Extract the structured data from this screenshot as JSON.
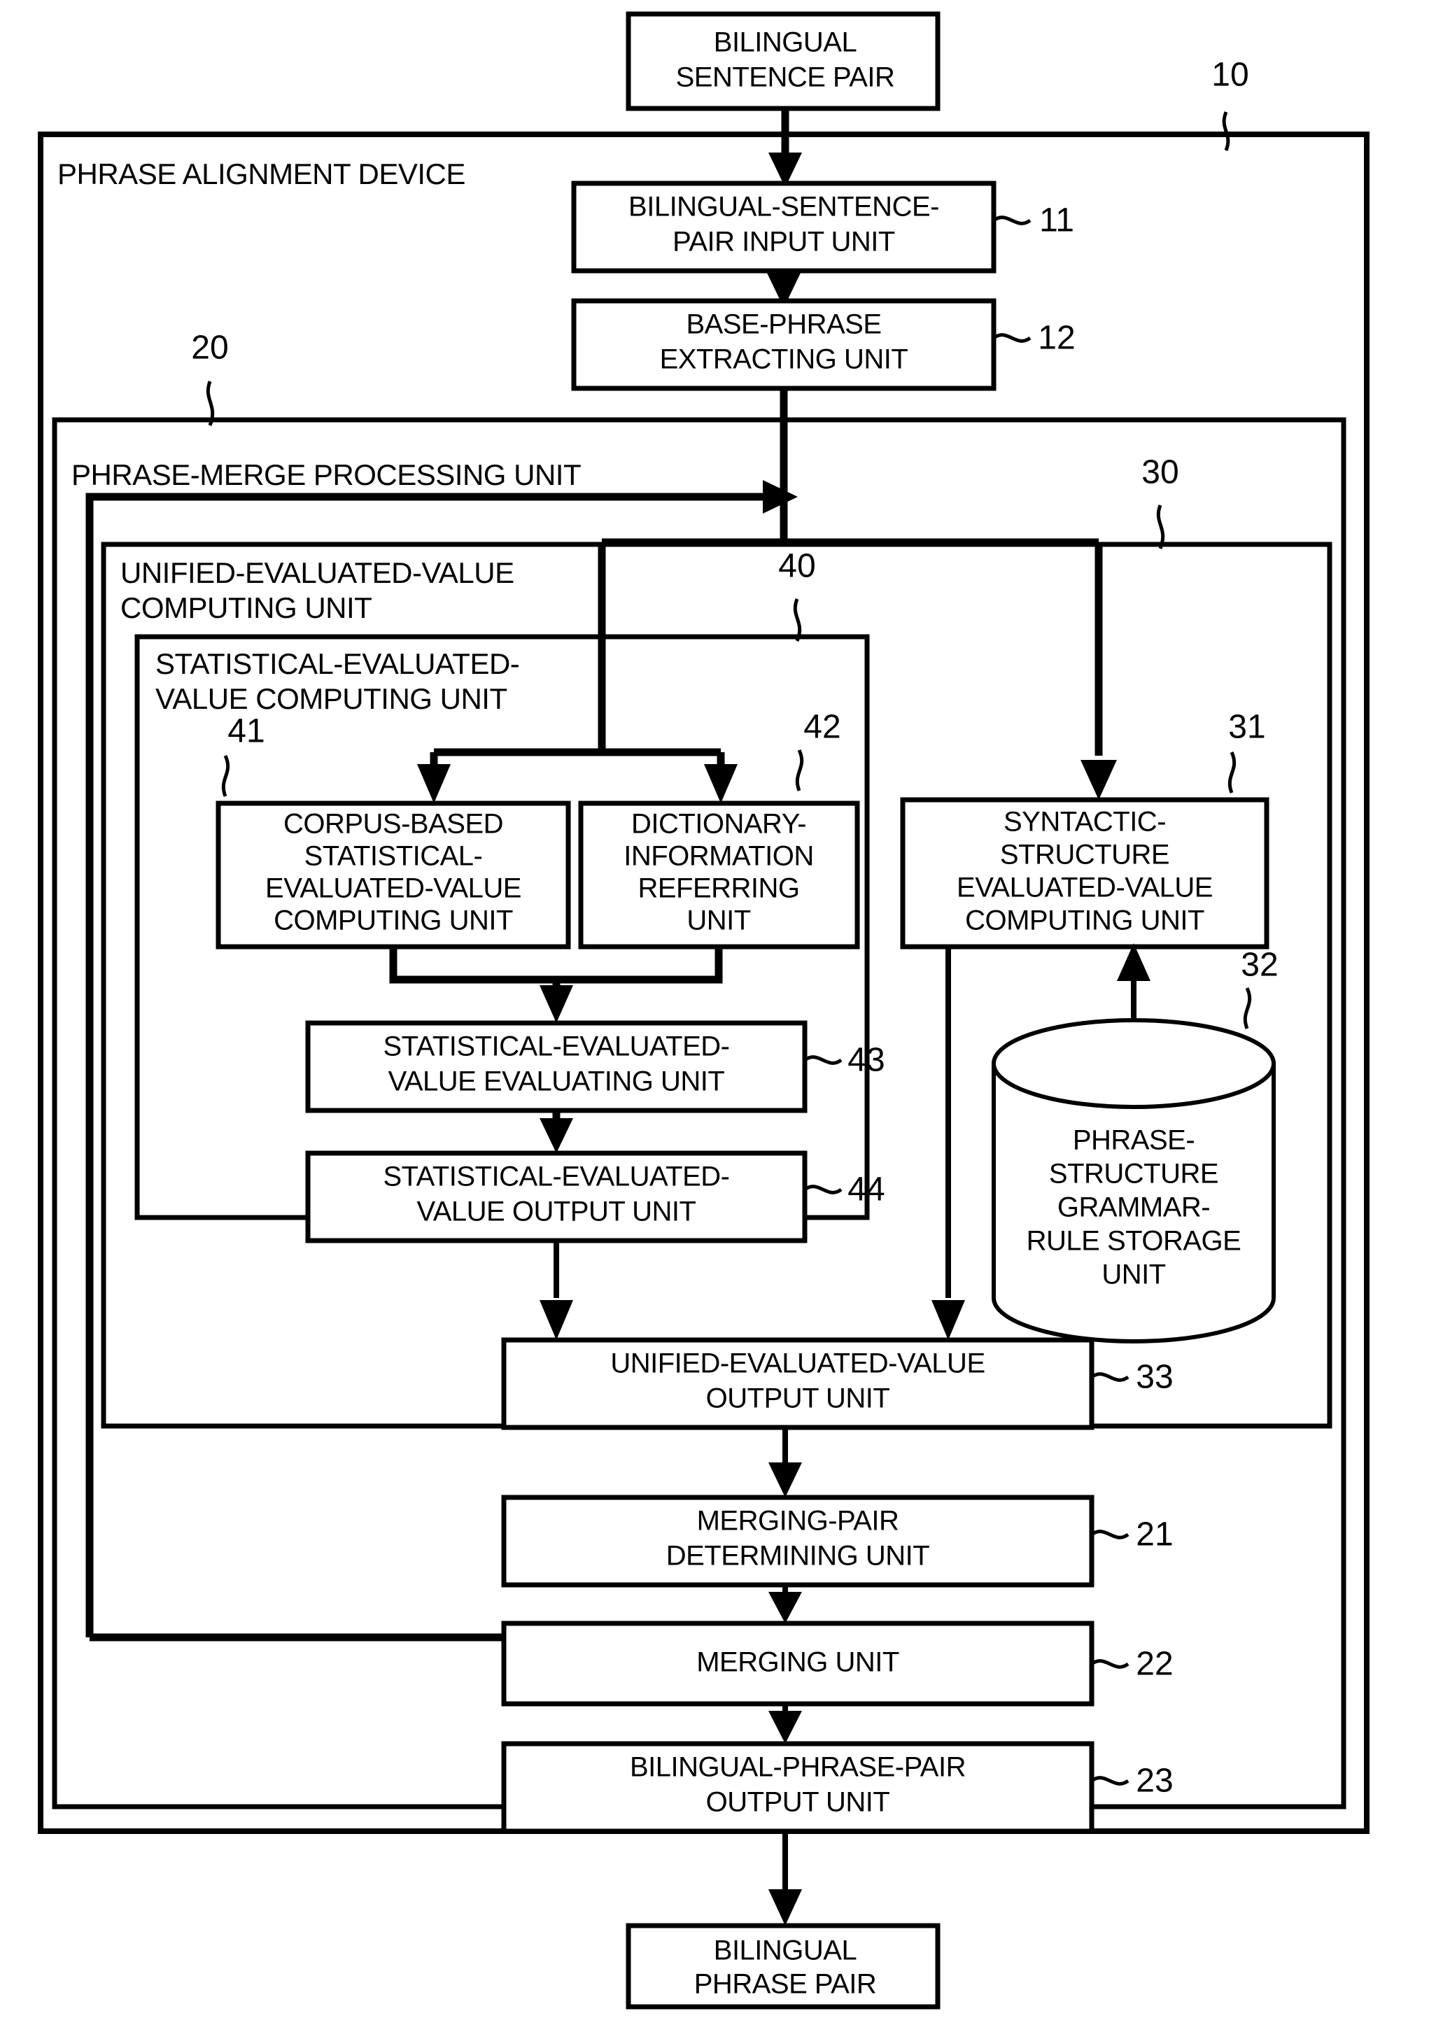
{
  "figure": {
    "type": "patent-block-diagram",
    "title": "PHRASE ALIGNMENT DEVICE"
  },
  "terminals": {
    "input": {
      "label_line1": "BILINGUAL",
      "label_line2": "SENTENCE PAIR"
    },
    "output": {
      "label_line1": "BILINGUAL",
      "label_line2": "PHRASE PAIR"
    }
  },
  "containers": {
    "device": {
      "label": "PHRASE ALIGNMENT DEVICE",
      "ref": "10"
    },
    "merge": {
      "label": "PHRASE-MERGE PROCESSING UNIT",
      "ref": "20"
    },
    "unified": {
      "label_line1": "UNIFIED-EVALUATED-VALUE",
      "label_line2": "COMPUTING UNIT",
      "ref": "30"
    },
    "statistical": {
      "label_line1": "STATISTICAL-EVALUATED-",
      "label_line2": "VALUE COMPUTING UNIT",
      "ref": "40"
    }
  },
  "blocks": [
    {
      "id": "b11",
      "ref": "11",
      "lines": [
        "BILINGUAL-SENTENCE-",
        "PAIR INPUT UNIT"
      ]
    },
    {
      "id": "b12",
      "ref": "12",
      "lines": [
        "BASE-PHRASE",
        "EXTRACTING UNIT"
      ]
    },
    {
      "id": "b41",
      "ref": "41",
      "lines": [
        "CORPUS-BASED",
        "STATISTICAL-",
        "EVALUATED-VALUE",
        "COMPUTING UNIT"
      ]
    },
    {
      "id": "b42",
      "ref": "42",
      "lines": [
        "DICTIONARY-",
        "INFORMATION",
        "REFERRING",
        "UNIT"
      ]
    },
    {
      "id": "b31",
      "ref": "31",
      "lines": [
        "SYNTACTIC-",
        "STRUCTURE",
        "EVALUATED-VALUE",
        "COMPUTING UNIT"
      ]
    },
    {
      "id": "b43",
      "ref": "43",
      "lines": [
        "STATISTICAL-EVALUATED-",
        "VALUE EVALUATING UNIT"
      ]
    },
    {
      "id": "b44",
      "ref": "44",
      "lines": [
        "STATISTICAL-EVALUATED-",
        "VALUE OUTPUT UNIT"
      ]
    },
    {
      "id": "b32",
      "ref": "32",
      "lines": [
        "PHRASE-",
        "STRUCTURE",
        "GRAMMAR-",
        "RULE STORAGE",
        "UNIT"
      ],
      "shape": "cylinder"
    },
    {
      "id": "b33",
      "ref": "33",
      "lines": [
        "UNIFIED-EVALUATED-VALUE",
        "OUTPUT UNIT"
      ]
    },
    {
      "id": "b21",
      "ref": "21",
      "lines": [
        "MERGING-PAIR",
        "DETERMINING UNIT"
      ]
    },
    {
      "id": "b22",
      "ref": "22",
      "lines": [
        "MERGING UNIT"
      ]
    },
    {
      "id": "b23",
      "ref": "23",
      "lines": [
        "BILINGUAL-PHRASE-PAIR",
        "OUTPUT UNIT"
      ]
    }
  ],
  "colors": {
    "stroke": "#000000",
    "fill": "#ffffff"
  }
}
